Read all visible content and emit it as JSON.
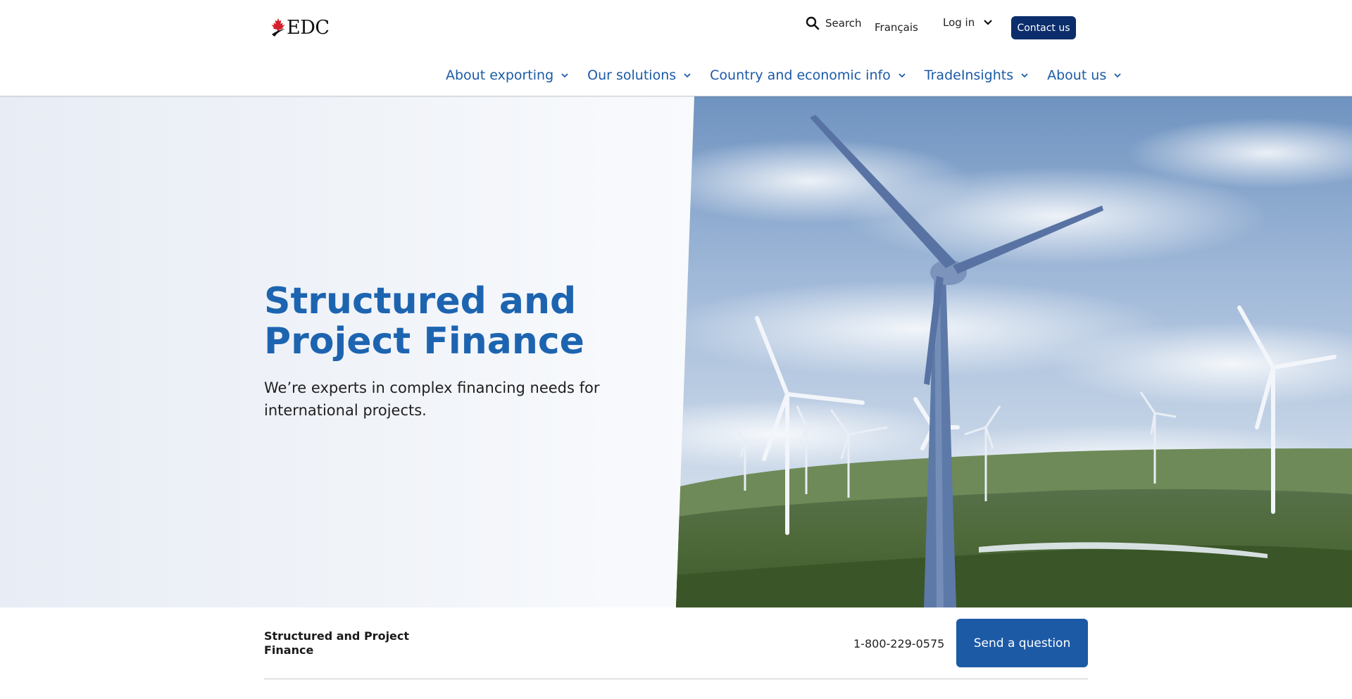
{
  "header": {
    "logo_text": "EDC",
    "search_label": "Search",
    "language_label": "Français",
    "login_label": "Log in",
    "contact_label": "Contact us",
    "brand_color": "#0b2d6b"
  },
  "nav": {
    "items": [
      {
        "label": "About exporting"
      },
      {
        "label": "Our solutions"
      },
      {
        "label": "Country and economic info"
      },
      {
        "label": "TradeInsights"
      },
      {
        "label": "About us"
      }
    ],
    "link_color": "#1b5aa6"
  },
  "hero": {
    "title": "Structured and Project Finance",
    "subtitle": "We’re experts in complex financing needs for international projects.",
    "image_subject": "wind-turbines-on-green-hills"
  },
  "subbar": {
    "title": "Structured and Project Finance",
    "phone": "1-800-229-0575",
    "send_label": "Send a question",
    "button_color": "#1d5aa6"
  }
}
